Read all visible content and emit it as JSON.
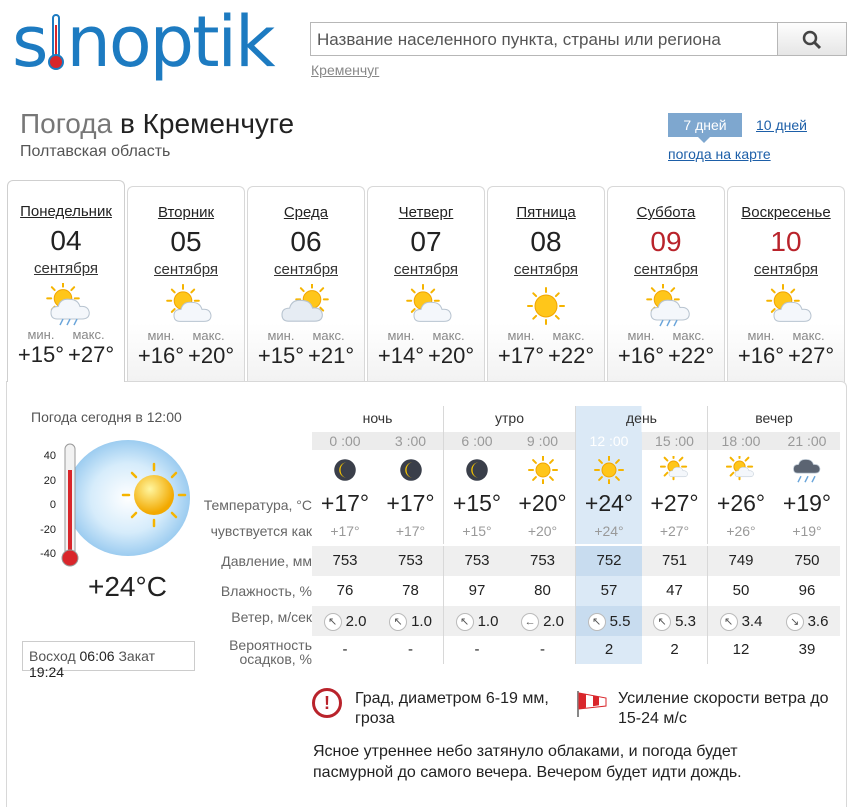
{
  "header": {
    "logo": "sinoptik",
    "search_placeholder": "Название населенного пункта, страны или региона",
    "recent_city": "Кременчуг"
  },
  "title": {
    "prefix": "Погода",
    "city": "в Кременчуге"
  },
  "region": "Полтавская область",
  "tabs": {
    "seven": "7 дней",
    "ten": "10 дней",
    "map": "погода на карте"
  },
  "days": [
    {
      "name": "Понедельник",
      "date": "04",
      "month": "сентября",
      "min_label": "мин.",
      "max_label": "макс.",
      "min": "+15°",
      "max": "+27°",
      "icon": "sun-cloud-rain-icon",
      "holiday": false
    },
    {
      "name": "Вторник",
      "date": "05",
      "month": "сентября",
      "min_label": "мин.",
      "max_label": "макс.",
      "min": "+16°",
      "max": "+20°",
      "icon": "sun-cloud-icon",
      "holiday": false
    },
    {
      "name": "Среда",
      "date": "06",
      "month": "сентября",
      "min_label": "мин.",
      "max_label": "макс.",
      "min": "+15°",
      "max": "+21°",
      "icon": "cloud-sun-icon",
      "holiday": false
    },
    {
      "name": "Четверг",
      "date": "07",
      "month": "сентября",
      "min_label": "мин.",
      "max_label": "макс.",
      "min": "+14°",
      "max": "+20°",
      "icon": "sun-cloud-icon",
      "holiday": false
    },
    {
      "name": "Пятница",
      "date": "08",
      "month": "сентября",
      "min_label": "мин.",
      "max_label": "макс.",
      "min": "+17°",
      "max": "+22°",
      "icon": "sun-icon",
      "holiday": false
    },
    {
      "name": "Суббота",
      "date": "09",
      "month": "сентября",
      "min_label": "мин.",
      "max_label": "макс.",
      "min": "+16°",
      "max": "+22°",
      "icon": "sun-cloud-rain-icon",
      "holiday": true
    },
    {
      "name": "Воскресенье",
      "date": "10",
      "month": "сентября",
      "min_label": "мин.",
      "max_label": "макс.",
      "min": "+16°",
      "max": "+27°",
      "icon": "sun-cloud-icon",
      "holiday": true
    }
  ],
  "now": {
    "label": "Погода сегодня в 12:00",
    "temp": "+24°C",
    "scale": [
      "40",
      "20",
      "0",
      "-20",
      "-40"
    ],
    "sunrise_label": "Восход",
    "sunrise": "06:06",
    "sunset_label": "Закат",
    "sunset": "19:24"
  },
  "table": {
    "periods": [
      "ночь",
      "утро",
      "день",
      "вечер"
    ],
    "times": [
      "0 :00",
      "3 :00",
      "6 :00",
      "9 :00",
      "12 :00",
      "15 :00",
      "18 :00",
      "21 :00"
    ],
    "icons": [
      "moon-cloud-icon",
      "moon-cloud-icon",
      "moon-cloud-icon",
      "sun-icon",
      "sun-icon",
      "sun-cloud-icon",
      "sun-cloud-icon",
      "cloud-rain-icon"
    ],
    "labels": {
      "temp": "Температура, °C",
      "feel": "чувствуется как",
      "pressure": "Давление, мм",
      "humidity": "Влажность, %",
      "wind": "Ветер, м/сек",
      "precip": "Вероятность осадков, %"
    },
    "temp": [
      "+17°",
      "+17°",
      "+15°",
      "+20°",
      "+24°",
      "+27°",
      "+26°",
      "+19°"
    ],
    "feel": [
      "+17°",
      "+17°",
      "+15°",
      "+20°",
      "+24°",
      "+27°",
      "+26°",
      "+19°"
    ],
    "pressure": [
      "753",
      "753",
      "753",
      "753",
      "752",
      "751",
      "749",
      "750"
    ],
    "humidity": [
      "76",
      "78",
      "97",
      "80",
      "57",
      "47",
      "50",
      "96"
    ],
    "wind": [
      "2.0",
      "1.0",
      "1.0",
      "2.0",
      "5.5",
      "5.3",
      "3.4",
      "3.6"
    ],
    "wind_dir": [
      "↖",
      "↖",
      "↖",
      "←",
      "↖",
      "↖",
      "↖",
      "↘"
    ],
    "precip": [
      "-",
      "-",
      "-",
      "-",
      "2",
      "2",
      "12",
      "39"
    ]
  },
  "alerts": {
    "hail": "Град, диаметром 6-19 мм, гроза",
    "wind": "Усиление скорости ветра до 15-24 м/с"
  },
  "description": "Ясное утреннее небо затянуло облаками, и погода будет пасмурной до самого вечера. Вечером будет идти дождь.",
  "colors": {
    "brand": "#1d7bc1",
    "holiday": "#b9232b",
    "highlight": "#dbe9f6",
    "active_time": "#4f95d3"
  }
}
